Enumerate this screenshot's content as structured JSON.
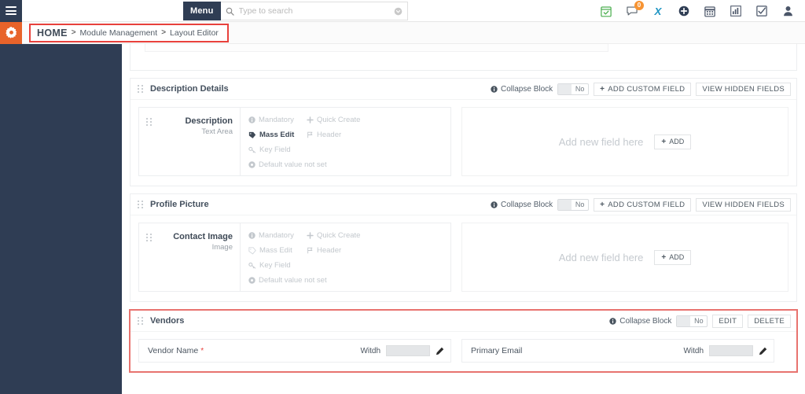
{
  "topbar": {
    "menu_label": "Menu",
    "search_placeholder": "Type to search",
    "search_value": "",
    "icons": [
      {
        "name": "calendar-check-icon",
        "color": "#4caf50"
      },
      {
        "name": "chat-icon",
        "badge": "0",
        "badge_color": "#f79433"
      },
      {
        "name": "x-logo-icon",
        "color": "#2196c4"
      },
      {
        "name": "plus-circle-icon",
        "color": "#2f3d54"
      },
      {
        "name": "calendar-icon",
        "color": "#4a5568"
      },
      {
        "name": "chart-icon",
        "color": "#4a5568"
      },
      {
        "name": "checkbox-icon",
        "color": "#4a5568"
      },
      {
        "name": "user-icon",
        "color": "#4a5568"
      }
    ]
  },
  "breadcrumb": {
    "home": "HOME",
    "separator": ">",
    "items": [
      "Module Management",
      "Layout Editor"
    ],
    "highlight_color": "#e8413c"
  },
  "blocks": [
    {
      "title": "Description Details",
      "collapse_label": "Collapse Block",
      "collapse_value": "No",
      "buttons": [
        {
          "label": "ADD CUSTOM FIELD",
          "plus": "+"
        },
        {
          "label": "VIEW HIDDEN FIELDS",
          "plus": ""
        }
      ],
      "field": {
        "name": "Description",
        "type": "Text Area",
        "props": [
          {
            "label": "Mandatory",
            "active": false,
            "icon": "info-icon"
          },
          {
            "label": "Quick Create",
            "active": false,
            "icon": "plus-icon"
          },
          {
            "label": "Mass Edit",
            "active": true,
            "icon": "tag-icon"
          },
          {
            "label": "Header",
            "active": false,
            "icon": "flag-icon"
          },
          {
            "label": "Key Field",
            "active": false,
            "icon": "key-icon"
          },
          {
            "label": "Default value not set",
            "active": false,
            "icon": "circle-icon"
          }
        ]
      },
      "dropzone": {
        "text": "Add new field here",
        "button": "ADD",
        "plus": "+"
      }
    },
    {
      "title": "Profile Picture",
      "collapse_label": "Collapse Block",
      "collapse_value": "No",
      "buttons": [
        {
          "label": "ADD CUSTOM FIELD",
          "plus": "+"
        },
        {
          "label": "VIEW HIDDEN FIELDS",
          "plus": ""
        }
      ],
      "field": {
        "name": "Contact Image",
        "type": "Image",
        "props": [
          {
            "label": "Mandatory",
            "active": false,
            "icon": "info-icon"
          },
          {
            "label": "Quick Create",
            "active": false,
            "icon": "plus-icon"
          },
          {
            "label": "Mass Edit",
            "active": false,
            "icon": "tag-icon"
          },
          {
            "label": "Header",
            "active": false,
            "icon": "flag-icon"
          },
          {
            "label": "Key Field",
            "active": false,
            "icon": "key-icon"
          },
          {
            "label": "Default value not set",
            "active": false,
            "icon": "circle-icon"
          }
        ]
      },
      "dropzone": {
        "text": "Add new field here",
        "button": "ADD",
        "plus": "+"
      }
    }
  ],
  "vendors": {
    "title": "Vendors",
    "collapse_label": "Collapse Block",
    "collapse_value": "No",
    "edit_label": "EDIT",
    "delete_label": "DELETE",
    "highlight_color": "#e8736f",
    "fields": [
      {
        "label": "Vendor Name",
        "required": true,
        "width_label": "Witdh",
        "width_value": ""
      },
      {
        "label": "Primary Email",
        "required": false,
        "width_label": "Witdh",
        "width_value": ""
      }
    ]
  },
  "theme": {
    "navy": "#2f3d54",
    "orange": "#e8632a",
    "red": "#e8413c",
    "text": "#3f4a57",
    "muted": "#c3c8cd"
  }
}
